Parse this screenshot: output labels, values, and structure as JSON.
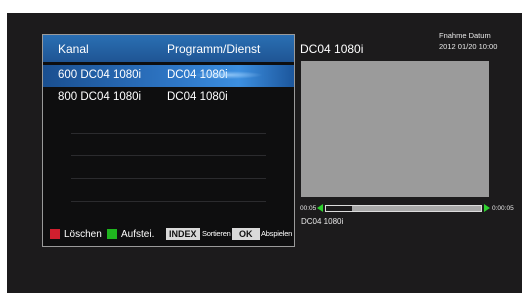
{
  "list": {
    "header": {
      "col1": "Kanal",
      "col2": "Programm/Dienst"
    },
    "rows": [
      {
        "channel": "600 DC04 1080i",
        "service": "DC04 1080i",
        "selected": true
      },
      {
        "channel": "800 DC04 1080i",
        "service": "DC04 1080i",
        "selected": false
      }
    ],
    "footer": {
      "delete_label": "Löschen",
      "delete_color": "#d11f2e",
      "record_label": "Aufstei.",
      "record_color": "#1fb51f",
      "index_key": "INDEX",
      "sort_label": "Sortieren",
      "ok_key": "OK",
      "play_label": "Abspielen"
    }
  },
  "info": {
    "channel_title": "DC04  1080i",
    "date_label": "Fnahme Datum",
    "date_value": "2012 01/20  10:00",
    "time_start": "00:05",
    "time_end": "0:00:05",
    "progress_fraction": 0.17,
    "program_name": "DC04  1080i"
  },
  "colors": {
    "accent": "#2a6fb3",
    "arrow": "#2ed12e",
    "background": "#1c1b1c"
  }
}
